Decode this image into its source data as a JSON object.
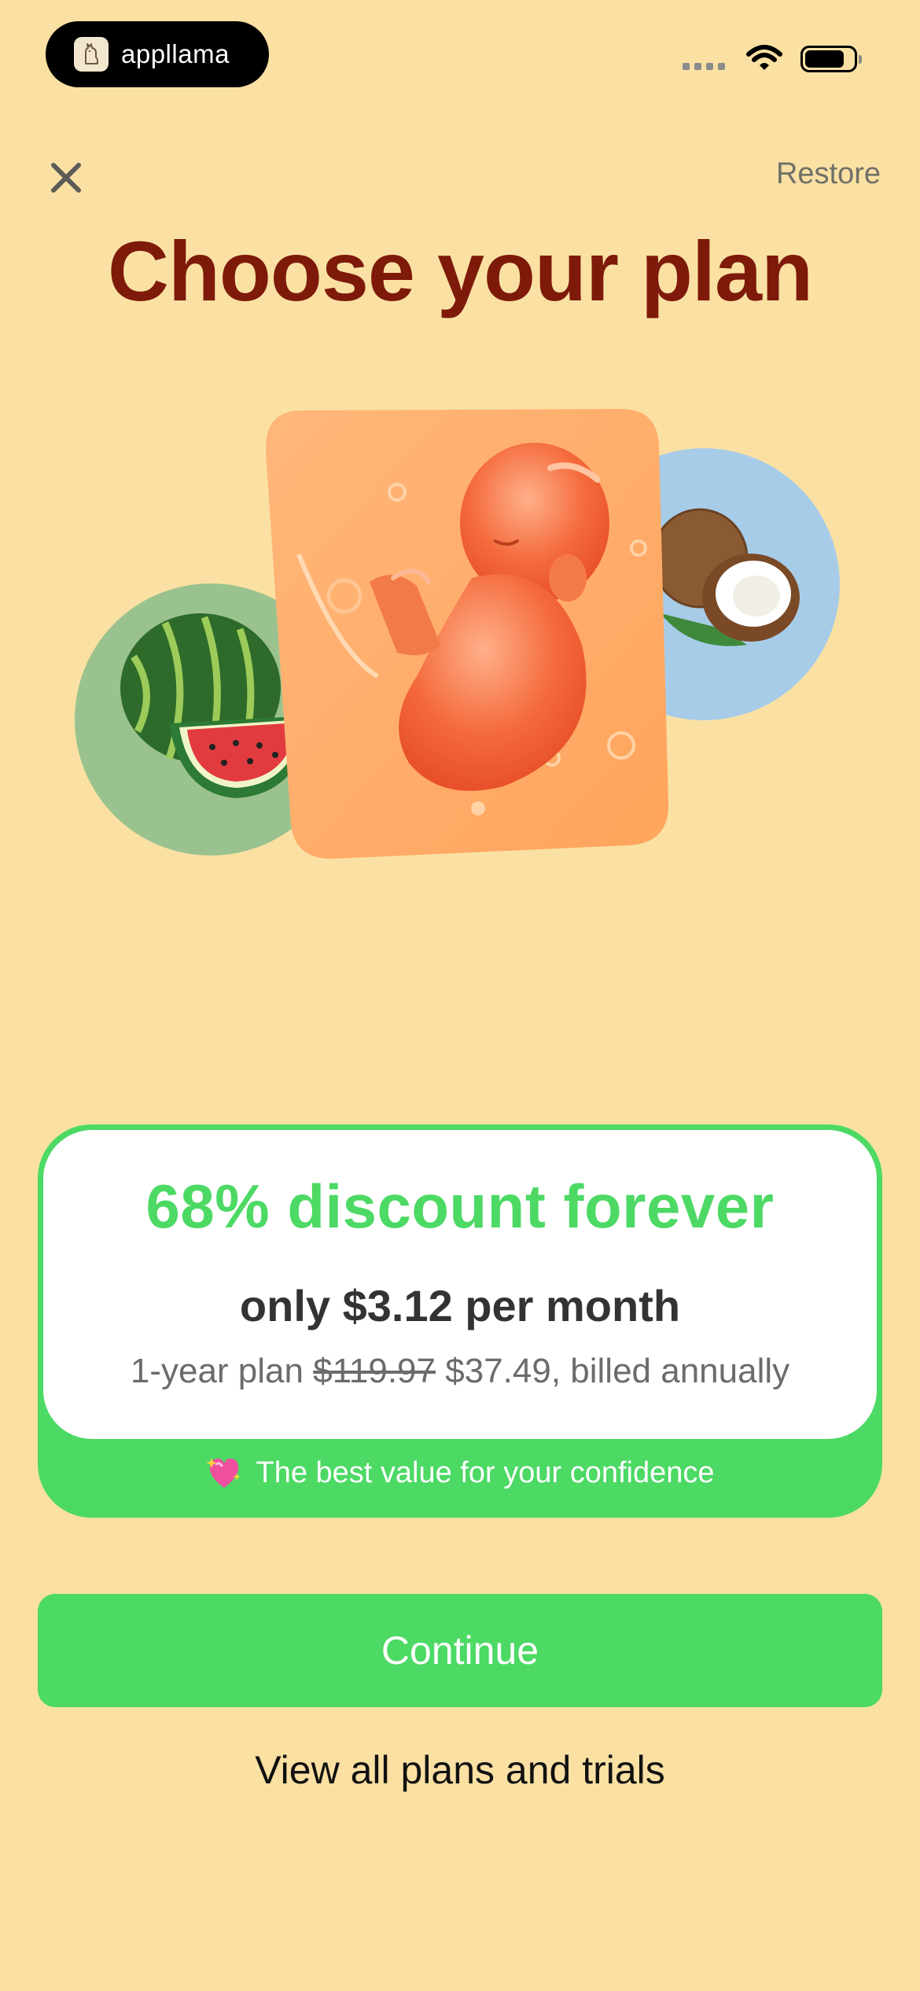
{
  "status_bar": {
    "app_name": "appllama",
    "logo_icon": "llama-icon",
    "icons": [
      "cellular-signal-icon",
      "wifi-icon",
      "battery-icon"
    ]
  },
  "header": {
    "close_icon": "close-icon",
    "restore_label": "Restore",
    "title": "Choose your plan"
  },
  "hero": {
    "images": [
      "watermelon-image",
      "baby-fetus-image",
      "coconut-image"
    ]
  },
  "offer": {
    "headline": "68% discount forever",
    "price_line": "only $3.12 per month",
    "plan_prefix": "1-year plan",
    "old_price": "$119.97",
    "new_price_suffix": "$37.49, billed annually",
    "footer_icon": "sparkling-heart-icon",
    "footer_text": "The best value for your confidence"
  },
  "actions": {
    "continue_label": "Continue",
    "view_plans_label": "View all plans and trials"
  },
  "colors": {
    "background": "#FAE1A3",
    "title": "#7E1A0A",
    "accent_green": "#4CD964",
    "card_orange": "#FFAE68",
    "watermelon_circle": "#9AC28E",
    "coconut_circle": "#A7CCE8"
  }
}
